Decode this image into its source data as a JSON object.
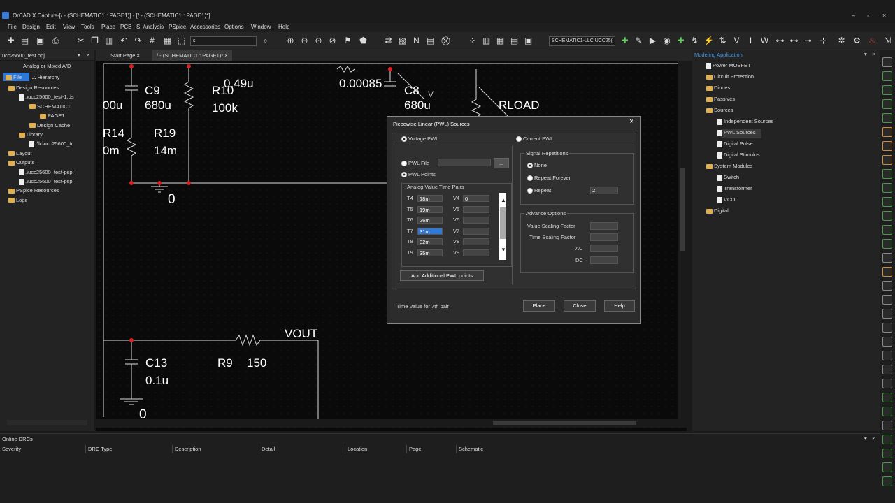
{
  "window": {
    "title": "OrCAD X Capture-[/ - (SCHEMATIC1 : PAGE1)] - [/ - (SCHEMATIC1 : PAGE1)*]",
    "brand": "cadence",
    "controls": [
      "–",
      "▫",
      "×"
    ]
  },
  "menu": [
    "File",
    "Design",
    "Edit",
    "View",
    "Tools",
    "Place",
    "PCB",
    "SI Analysis",
    "PSpice",
    "Accessories",
    "Options",
    "Window",
    "Help"
  ],
  "toolbar": {
    "zoom_field": "s",
    "schematic_select": "SCHEMATIC1-LLC UCC25("
  },
  "project": {
    "file": "ucc25600_test.opj",
    "mode": "Analog or Mixed A/D",
    "tabs": [
      "File",
      "Hierarchy"
    ],
    "tree": [
      {
        "label": "Design Resources",
        "indent": 0,
        "type": "folder"
      },
      {
        "label": ".\\ucc25600_test-1.ds",
        "indent": 1,
        "type": "doc"
      },
      {
        "label": "SCHEMATIC1",
        "indent": 2,
        "type": "folder"
      },
      {
        "label": "PAGE1",
        "indent": 3,
        "type": "folder"
      },
      {
        "label": "Design Cache",
        "indent": 2,
        "type": "folder"
      },
      {
        "label": "Library",
        "indent": 1,
        "type": "folder"
      },
      {
        "label": ".\\lc\\ucc25600_tr",
        "indent": 2,
        "type": "doc"
      },
      {
        "label": "Layout",
        "indent": 0,
        "type": "folder"
      },
      {
        "label": "Outputs",
        "indent": 0,
        "type": "folder"
      },
      {
        "label": ".\\ucc25600_test-pspi",
        "indent": 1,
        "type": "doc"
      },
      {
        "label": ".\\ucc25600_test-pspi",
        "indent": 1,
        "type": "doc"
      },
      {
        "label": "PSpice Resources",
        "indent": 0,
        "type": "folder"
      },
      {
        "label": "Logs",
        "indent": 0,
        "type": "folder"
      }
    ]
  },
  "doc_tabs": [
    "Start Page",
    "/ - (SCHEMATIC1 : PAGE1)*"
  ],
  "schematic": {
    "labels": [
      "C9",
      "680u",
      "R10",
      "100k",
      "0.49u",
      "00u",
      "R14",
      "0m",
      "R19",
      "14m",
      "0",
      "0.00085",
      "C8",
      "680u",
      "V",
      "RLOAD",
      "C13",
      "0.1u",
      "R9",
      "150",
      "VOUT",
      "0"
    ]
  },
  "modeling": {
    "title": "Modeling Application",
    "tree": [
      {
        "label": "Power MOSFET",
        "indent": 1,
        "type": "doc"
      },
      {
        "label": "Circuit Protection",
        "indent": 1,
        "type": "folder"
      },
      {
        "label": "Diodes",
        "indent": 1,
        "type": "folder"
      },
      {
        "label": "Passives",
        "indent": 1,
        "type": "folder"
      },
      {
        "label": "Sources",
        "indent": 1,
        "type": "folder"
      },
      {
        "label": "Independent Sources",
        "indent": 2,
        "type": "doc"
      },
      {
        "label": "PWL Sources",
        "indent": 2,
        "type": "doc"
      },
      {
        "label": "Digital Pulse",
        "indent": 2,
        "type": "doc"
      },
      {
        "label": "Digital Stimulus",
        "indent": 2,
        "type": "doc"
      },
      {
        "label": "System Modules",
        "indent": 1,
        "type": "folder"
      },
      {
        "label": "Switch",
        "indent": 2,
        "type": "doc"
      },
      {
        "label": "Transformer",
        "indent": 2,
        "type": "doc"
      },
      {
        "label": "VCO",
        "indent": 2,
        "type": "doc"
      },
      {
        "label": "Digital",
        "indent": 1,
        "type": "folder"
      }
    ]
  },
  "dialog": {
    "title": "Piecewise Linear (PWL) Sources",
    "voltage_pwl": "Voltage PWL",
    "current_pwl": "Current PWL",
    "pwl_file": "PWL File",
    "browse": "...",
    "pwl_points": "PWL Points",
    "pairs_title": "Analog Value Time Pairs",
    "pairs": [
      {
        "t": "T4",
        "tv": "18m",
        "v": "V4",
        "vv": "0"
      },
      {
        "t": "T5",
        "tv": "19m",
        "v": "V5",
        "vv": ""
      },
      {
        "t": "T6",
        "tv": "26m",
        "v": "V6",
        "vv": ""
      },
      {
        "t": "T7",
        "tv": "31m",
        "v": "V7",
        "vv": ""
      },
      {
        "t": "T8",
        "tv": "32m",
        "v": "V8",
        "vv": ""
      },
      {
        "t": "T9",
        "tv": "35m",
        "v": "V9",
        "vv": ""
      }
    ],
    "add_points": "Add Additional PWL points",
    "signal_rep": "Signal Repetitions",
    "none": "None",
    "repeat_forever": "Repeat Forever",
    "repeat": "Repeat",
    "repeat_value": "2",
    "advance": "Advance Options",
    "value_scaling": "Value Scaling Factor",
    "time_scaling": "Time Scaling Factor",
    "ac": "AC",
    "dc": "DC",
    "status": "Time Value for 7th pair",
    "place": "Place",
    "close": "Close",
    "help": "Help"
  },
  "drc": {
    "title": "Online DRCs",
    "columns": [
      "Severity",
      "DRC Type",
      "Description",
      "Detail",
      "Location",
      "Page",
      "Schematic"
    ]
  }
}
